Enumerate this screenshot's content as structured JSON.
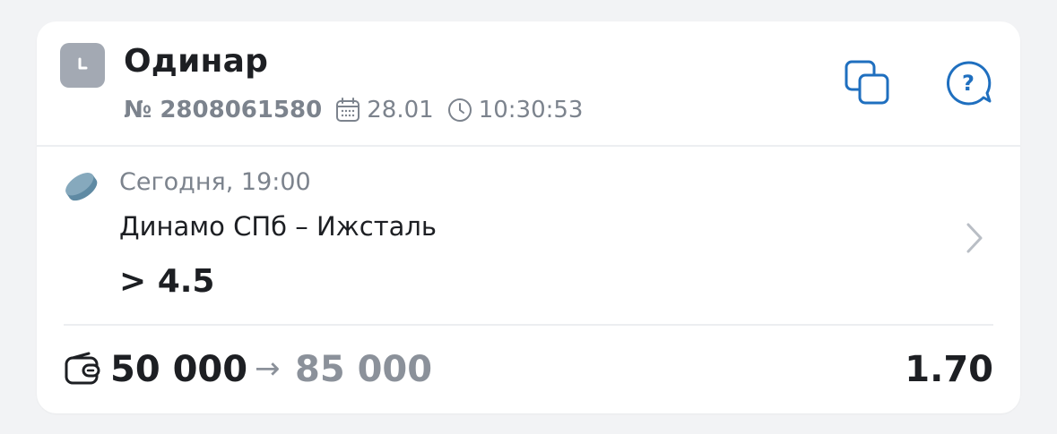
{
  "bet": {
    "type_title": "Одинар",
    "number": "№ 2808061580",
    "date": "28.01",
    "time": "10:30:53"
  },
  "event": {
    "when": "Сегодня, 19:00",
    "match": "Динамо СПб – Ижсталь",
    "pick": "> 4.5"
  },
  "footer": {
    "stake": "50 000",
    "arrow": "→",
    "payout": "85 000",
    "odds": "1.70"
  },
  "icons": {
    "status": "clock-icon",
    "date": "calendar-icon",
    "time": "clock-outline-icon",
    "copy": "copy-icon",
    "help": "help-chat-icon",
    "sport": "hockey-puck-icon",
    "open": "chevron-right-icon",
    "stake": "wallet-icon"
  },
  "colors": {
    "accent": "#1f6fbf",
    "status_bg": "#a3a9b3",
    "muted_text": "#7c838d",
    "sport_icon": "#6f93a8"
  }
}
